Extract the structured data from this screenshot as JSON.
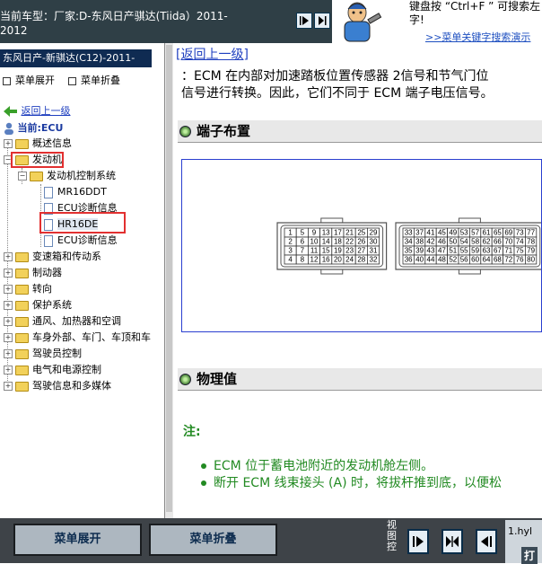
{
  "header": {
    "car_label": "当前车型：厂家:D-东风日产骐达(Tiida）2011-2012"
  },
  "help": {
    "text": "键盘按 “Ctrl+F ” 可搜索左字!",
    "link": ">>菜单关键字搜索演示"
  },
  "left": {
    "title": "东风日产-新骐达(C12)-2011-",
    "expand_label": "菜单展开",
    "collapse_label": "菜单折叠",
    "back_label": "返回上一级",
    "current_label": "当前:ECU",
    "tree": {
      "overview": "概述信息",
      "engine": "发动机",
      "engine_ctrl": "发动机控制系统",
      "mr16ddt": "MR16DDT",
      "ecu_diag_1": "ECU诊断信息",
      "hr16de": "HR16DE",
      "ecu_diag_2": "ECU诊断信息",
      "transmission": "变速箱和传动系",
      "brake": "制动器",
      "steering": "转向",
      "protection": "保护系统",
      "hvac": "通风、加热器和空调",
      "body": "车身外部、车门、车顶和车",
      "driver_ctrl": "驾驶员控制",
      "electrical": "电气和电源控制",
      "driver_info": "驾驶信息和多媒体"
    }
  },
  "main": {
    "back_link": "[返回上一级]",
    "para_line1": "：ECM 在内部对加速踏板位置传感器 2信号和节气门位",
    "para_line2": "信号进行转换。因此，它们不同于  ECM 端子电压信号。",
    "section1": "端子布置",
    "section2": "物理值",
    "note_label": "注:",
    "bullet1": "ECM 位于蓄电池附近的发动机舱左侧。",
    "bullet2": "断开  ECM 线束接头  (A) 时，将拔杆推到底，以便松"
  },
  "connector": {
    "left_rows": [
      [
        "1",
        "5",
        "9",
        "13",
        "17",
        "21",
        "25",
        "29"
      ],
      [
        "2",
        "6",
        "10",
        "14",
        "18",
        "22",
        "26",
        "30"
      ],
      [
        "3",
        "7",
        "11",
        "15",
        "19",
        "23",
        "27",
        "31"
      ],
      [
        "4",
        "8",
        "12",
        "16",
        "20",
        "24",
        "28",
        "32"
      ]
    ],
    "right_rows": [
      [
        "33",
        "37",
        "41",
        "45",
        "49",
        "53",
        "57",
        "61",
        "65",
        "69",
        "73",
        "77"
      ],
      [
        "34",
        "38",
        "42",
        "46",
        "50",
        "54",
        "58",
        "62",
        "66",
        "70",
        "74",
        "78"
      ],
      [
        "35",
        "39",
        "43",
        "47",
        "51",
        "55",
        "59",
        "63",
        "67",
        "71",
        "75",
        "79"
      ],
      [
        "36",
        "40",
        "44",
        "48",
        "52",
        "56",
        "60",
        "64",
        "68",
        "72",
        "76",
        "80"
      ]
    ]
  },
  "bottom": {
    "expand_label": "菜单展开",
    "collapse_label": "菜单折叠",
    "view_label": "视图控",
    "side_text": "1.hyl",
    "side_btn": "打"
  }
}
